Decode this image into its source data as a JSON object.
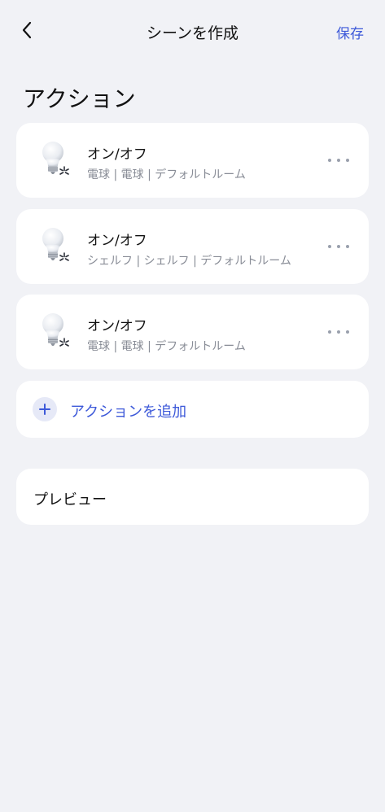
{
  "header": {
    "title": "シーンを作成",
    "save_label": "保存",
    "back_icon": "chevron-left-icon"
  },
  "section": {
    "title": "アクション"
  },
  "actions": [
    {
      "title": "オン/オフ",
      "subtitle": "電球 | 電球 | デフォルトルーム",
      "icon": "light-bulb-icon"
    },
    {
      "title": "オン/オフ",
      "subtitle": "シェルフ | シェルフ | デフォルトルーム",
      "icon": "light-bulb-icon"
    },
    {
      "title": "オン/オフ",
      "subtitle": "電球 | 電球 | デフォルトルーム",
      "icon": "light-bulb-icon"
    }
  ],
  "add_action": {
    "label": "アクションを追加",
    "icon": "plus-icon"
  },
  "preview": {
    "label": "プレビュー"
  },
  "colors": {
    "background": "#F1F2F6",
    "card": "#FFFFFF",
    "accent": "#3D59D9",
    "secondary_text": "#888C96"
  }
}
